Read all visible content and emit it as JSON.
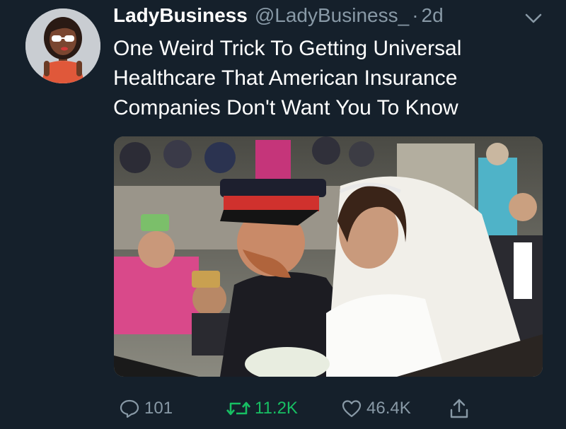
{
  "tweet": {
    "display_name": "LadyBusiness",
    "handle": "@LadyBusiness_",
    "separator": "·",
    "time": "2d",
    "text_lines": [
      "One Weird Trick To Getting Universal",
      "Healthcare That American Insurance",
      "Companies Don't Want You To Know"
    ]
  },
  "actions": {
    "replies": "101",
    "retweets": "11.2K",
    "likes": "46.4K"
  },
  "icons": {
    "more": "chevron-down-icon",
    "reply": "reply-icon",
    "retweet": "retweet-icon",
    "like": "heart-icon",
    "share": "share-icon"
  },
  "colors": {
    "background": "#15202b",
    "secondary_text": "#8899a6",
    "retweet_active": "#17bf63"
  }
}
